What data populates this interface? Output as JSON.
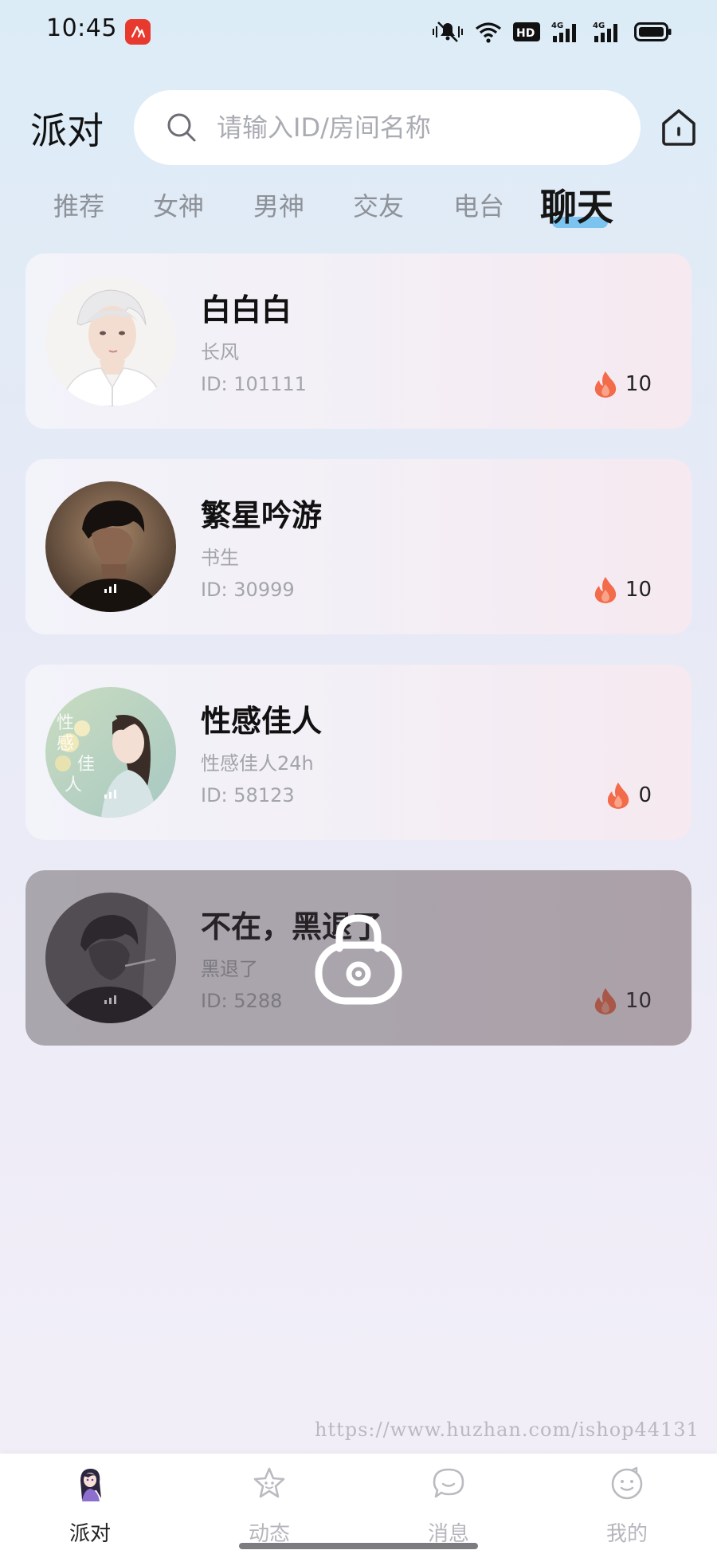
{
  "status_bar": {
    "time": "10:45",
    "network_badge": "HD",
    "signal_labels": [
      "4G",
      "4G"
    ]
  },
  "header": {
    "title": "派对",
    "search": {
      "placeholder": "请输入ID/房间名称",
      "value": ""
    },
    "home_icon": "home-icon"
  },
  "tabs": [
    {
      "label": "推荐",
      "active": false
    },
    {
      "label": "女神",
      "active": false
    },
    {
      "label": "男神",
      "active": false
    },
    {
      "label": "交友",
      "active": false
    },
    {
      "label": "电台",
      "active": false
    },
    {
      "label": "聊天",
      "active": true
    }
  ],
  "rooms": [
    {
      "name": "白白白",
      "description": "长风",
      "id_text": "ID: 101111",
      "heat": "10",
      "locked": false
    },
    {
      "name": "繁星吟游",
      "description": "书生",
      "id_text": "ID: 30999",
      "heat": "10",
      "locked": false
    },
    {
      "name": "性感佳人",
      "description": "性感佳人24h",
      "id_text": "ID: 58123",
      "heat": "0",
      "locked": false
    },
    {
      "name": "不在，黑退了",
      "description": "黑退了",
      "id_text": "ID: 5288",
      "heat": "10",
      "locked": true
    }
  ],
  "watermark": "https://www.huzhan.com/ishop44131",
  "bottom_nav": [
    {
      "label": "派对",
      "icon": "party-avatar-icon",
      "active": true
    },
    {
      "label": "动态",
      "icon": "star-face-icon",
      "active": false
    },
    {
      "label": "消息",
      "icon": "chat-bubble-icon",
      "active": false
    },
    {
      "label": "我的",
      "icon": "smile-face-icon",
      "active": false
    }
  ],
  "colors": {
    "accent_tab_underline": "#7cc4ef",
    "fire": "#f26b4a",
    "muted_text": "#a3a5ab"
  }
}
